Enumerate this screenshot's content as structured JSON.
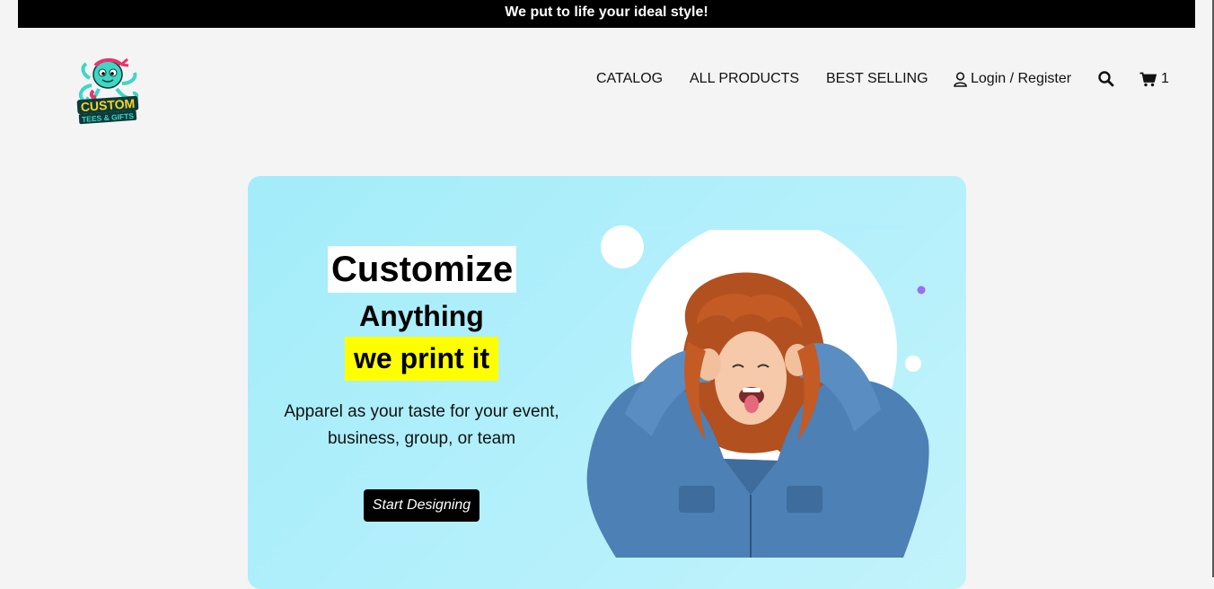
{
  "announcement": {
    "text": "We put to life your ideal style!"
  },
  "brand": {
    "logo_text": "CUSTOM TEES & GIFTS",
    "logo_line1": "CUSTOM",
    "logo_line2": "TEES & GIFTS"
  },
  "nav": {
    "items": [
      {
        "label": "CATALOG"
      },
      {
        "label": "ALL PRODUCTS"
      },
      {
        "label": "BEST SELLING"
      }
    ],
    "login_label": "Login / Register",
    "login_icon": "user-icon",
    "search_icon": "search-icon",
    "cart_icon": "cart-icon",
    "cart_count": "1"
  },
  "hero": {
    "headline_1": "Customize",
    "headline_2": "Anything",
    "headline_3": "we print it",
    "tagline": "Apparel as your taste for your event, business, group, or team",
    "cta_label": "Start Designing",
    "image_desc": "woman-with-red-curly-hair-photo"
  },
  "colors": {
    "announce_bg": "#000000",
    "hero_bg": "#b0effb",
    "highlight": "#fefe00",
    "accent_dot": "#9b6ef0"
  }
}
